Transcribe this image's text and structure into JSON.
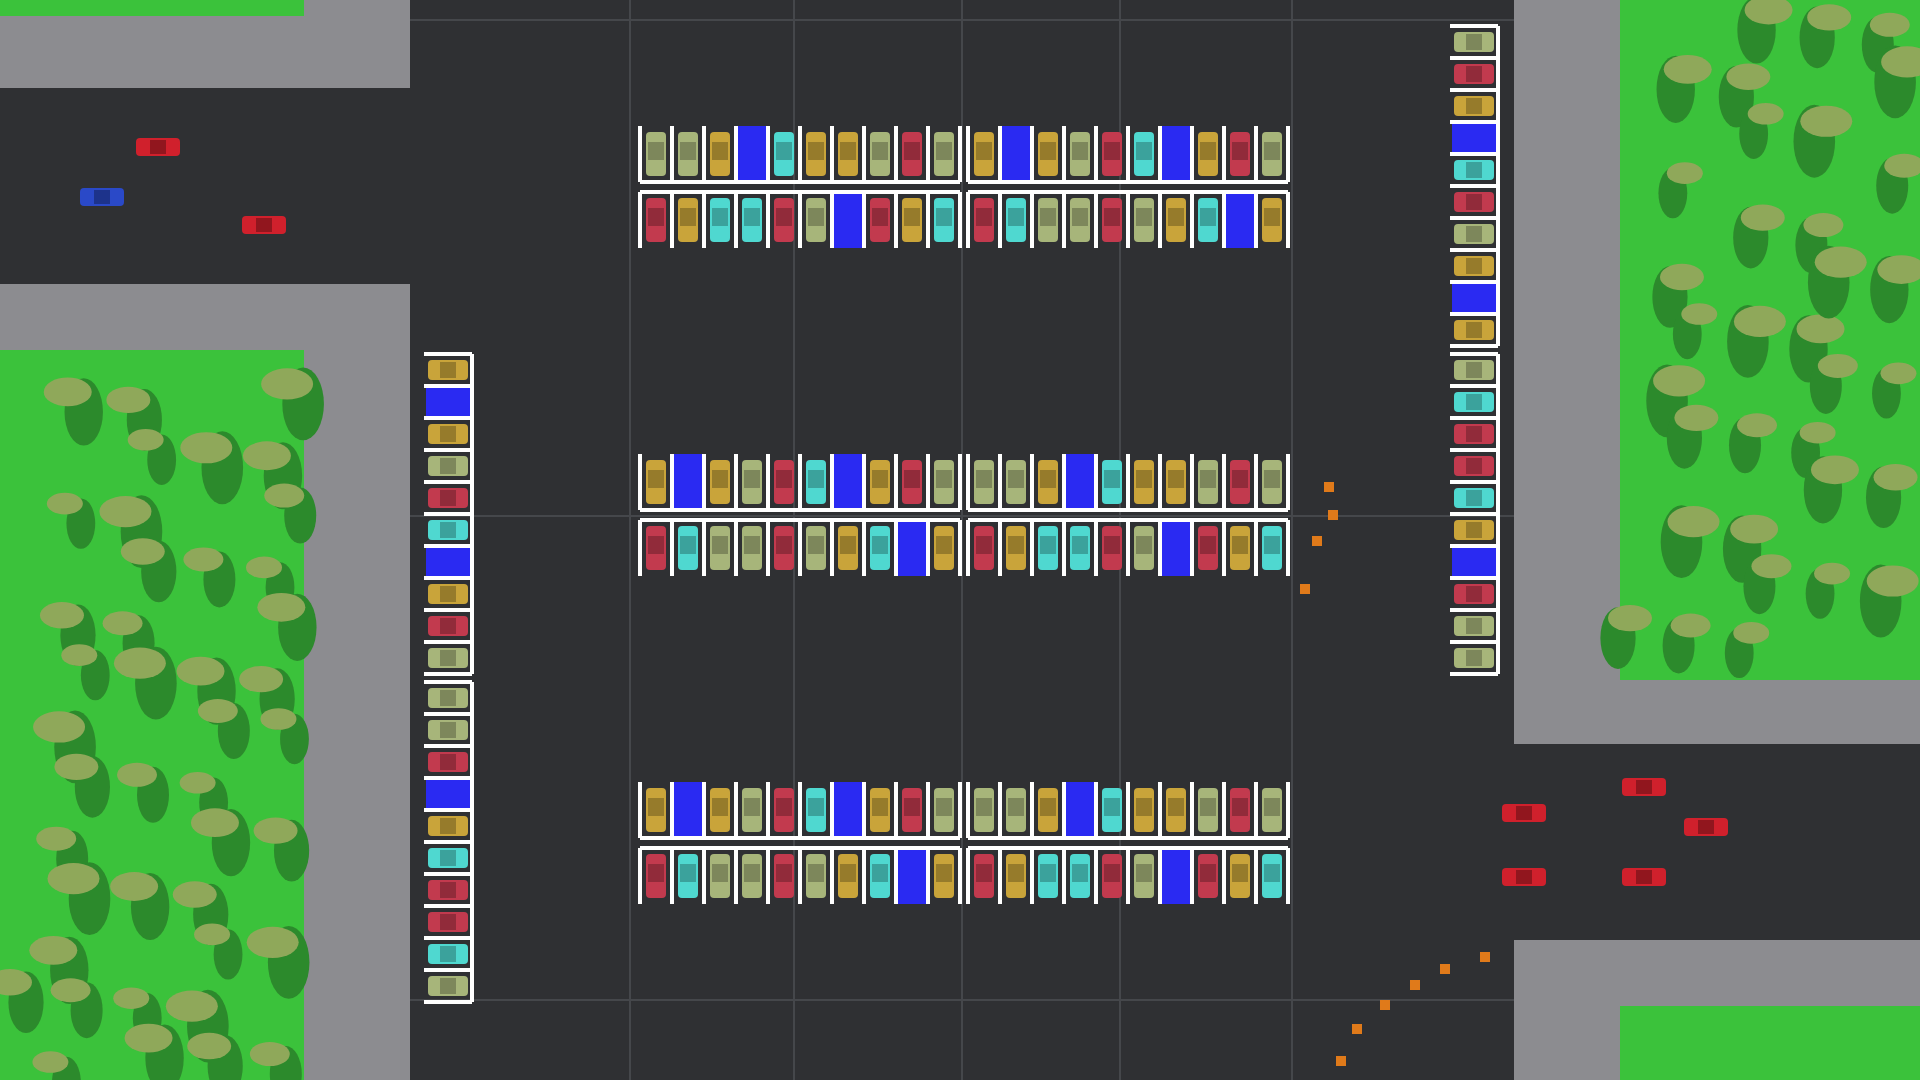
{
  "parking_rows": [
    {
      "spots": [
        {
          "kind": "car",
          "color": "#a7b57a"
        },
        {
          "kind": "car",
          "color": "#a7b57a"
        },
        {
          "kind": "car",
          "color": "#c9a43a"
        },
        {
          "kind": "empty"
        },
        {
          "kind": "car",
          "color": "#4fd8d0"
        },
        {
          "kind": "car",
          "color": "#c9a43a"
        },
        {
          "kind": "car",
          "color": "#c9a43a"
        },
        {
          "kind": "car",
          "color": "#a7b57a"
        },
        {
          "kind": "car",
          "color": "#c23a4e"
        },
        {
          "kind": "car",
          "color": "#a7b57a"
        },
        {
          "kind": "car",
          "color": "#c9a43a"
        },
        {
          "kind": "empty"
        },
        {
          "kind": "car",
          "color": "#c9a43a"
        },
        {
          "kind": "car",
          "color": "#a7b57a"
        },
        {
          "kind": "car",
          "color": "#c23a4e"
        },
        {
          "kind": "car",
          "color": "#4fd8d0"
        },
        {
          "kind": "empty"
        },
        {
          "kind": "car",
          "color": "#c9a43a"
        },
        {
          "kind": "car",
          "color": "#c23a4e"
        },
        {
          "kind": "car",
          "color": "#a7b57a"
        }
      ]
    },
    {
      "spots": [
        {
          "kind": "car",
          "color": "#c23a4e"
        },
        {
          "kind": "car",
          "color": "#c9a43a"
        },
        {
          "kind": "car",
          "color": "#4fd8d0"
        },
        {
          "kind": "car",
          "color": "#4fd8d0"
        },
        {
          "kind": "car",
          "color": "#c23a4e"
        },
        {
          "kind": "car",
          "color": "#a7b57a"
        },
        {
          "kind": "empty"
        },
        {
          "kind": "car",
          "color": "#c23a4e"
        },
        {
          "kind": "car",
          "color": "#c9a43a"
        },
        {
          "kind": "car",
          "color": "#4fd8d0"
        },
        {
          "kind": "car",
          "color": "#c23a4e"
        },
        {
          "kind": "car",
          "color": "#4fd8d0"
        },
        {
          "kind": "car",
          "color": "#a7b57a"
        },
        {
          "kind": "car",
          "color": "#a7b57a"
        },
        {
          "kind": "car",
          "color": "#c23a4e"
        },
        {
          "kind": "car",
          "color": "#a7b57a"
        },
        {
          "kind": "car",
          "color": "#c9a43a"
        },
        {
          "kind": "car",
          "color": "#4fd8d0"
        },
        {
          "kind": "empty"
        },
        {
          "kind": "car",
          "color": "#c9a43a"
        }
      ]
    },
    {
      "spots": [
        {
          "kind": "car",
          "color": "#c9a43a"
        },
        {
          "kind": "empty"
        },
        {
          "kind": "car",
          "color": "#c9a43a"
        },
        {
          "kind": "car",
          "color": "#a7b57a"
        },
        {
          "kind": "car",
          "color": "#c23a4e"
        },
        {
          "kind": "car",
          "color": "#4fd8d0"
        },
        {
          "kind": "empty"
        },
        {
          "kind": "car",
          "color": "#c9a43a"
        },
        {
          "kind": "car",
          "color": "#c23a4e"
        },
        {
          "kind": "car",
          "color": "#a7b57a"
        },
        {
          "kind": "car",
          "color": "#a7b57a"
        },
        {
          "kind": "car",
          "color": "#a7b57a"
        },
        {
          "kind": "car",
          "color": "#c9a43a"
        },
        {
          "kind": "empty"
        },
        {
          "kind": "car",
          "color": "#4fd8d0"
        },
        {
          "kind": "car",
          "color": "#c9a43a"
        },
        {
          "kind": "car",
          "color": "#c9a43a"
        },
        {
          "kind": "car",
          "color": "#a7b57a"
        },
        {
          "kind": "car",
          "color": "#c23a4e"
        },
        {
          "kind": "car",
          "color": "#a7b57a"
        }
      ]
    },
    {
      "spots": [
        {
          "kind": "car",
          "color": "#c23a4e"
        },
        {
          "kind": "car",
          "color": "#4fd8d0"
        },
        {
          "kind": "car",
          "color": "#a7b57a"
        },
        {
          "kind": "car",
          "color": "#a7b57a"
        },
        {
          "kind": "car",
          "color": "#c23a4e"
        },
        {
          "kind": "car",
          "color": "#a7b57a"
        },
        {
          "kind": "car",
          "color": "#c9a43a"
        },
        {
          "kind": "car",
          "color": "#4fd8d0"
        },
        {
          "kind": "empty"
        },
        {
          "kind": "car",
          "color": "#c9a43a"
        },
        {
          "kind": "car",
          "color": "#c23a4e"
        },
        {
          "kind": "car",
          "color": "#c9a43a"
        },
        {
          "kind": "car",
          "color": "#4fd8d0"
        },
        {
          "kind": "car",
          "color": "#4fd8d0"
        },
        {
          "kind": "car",
          "color": "#c23a4e"
        },
        {
          "kind": "car",
          "color": "#a7b57a"
        },
        {
          "kind": "empty"
        },
        {
          "kind": "car",
          "color": "#c23a4e"
        },
        {
          "kind": "car",
          "color": "#c9a43a"
        },
        {
          "kind": "car",
          "color": "#4fd8d0"
        }
      ]
    },
    {
      "spots": [
        {
          "kind": "car",
          "color": "#c9a43a"
        },
        {
          "kind": "empty"
        },
        {
          "kind": "car",
          "color": "#c9a43a"
        },
        {
          "kind": "car",
          "color": "#a7b57a"
        },
        {
          "kind": "car",
          "color": "#c23a4e"
        },
        {
          "kind": "car",
          "color": "#4fd8d0"
        },
        {
          "kind": "empty"
        },
        {
          "kind": "car",
          "color": "#c9a43a"
        },
        {
          "kind": "car",
          "color": "#c23a4e"
        },
        {
          "kind": "car",
          "color": "#a7b57a"
        },
        {
          "kind": "car",
          "color": "#a7b57a"
        },
        {
          "kind": "car",
          "color": "#a7b57a"
        },
        {
          "kind": "car",
          "color": "#c9a43a"
        },
        {
          "kind": "empty"
        },
        {
          "kind": "car",
          "color": "#4fd8d0"
        },
        {
          "kind": "car",
          "color": "#c9a43a"
        },
        {
          "kind": "car",
          "color": "#c9a43a"
        },
        {
          "kind": "car",
          "color": "#a7b57a"
        },
        {
          "kind": "car",
          "color": "#c23a4e"
        },
        {
          "kind": "car",
          "color": "#a7b57a"
        }
      ]
    },
    {
      "spots": [
        {
          "kind": "car",
          "color": "#c23a4e"
        },
        {
          "kind": "car",
          "color": "#4fd8d0"
        },
        {
          "kind": "car",
          "color": "#a7b57a"
        },
        {
          "kind": "car",
          "color": "#a7b57a"
        },
        {
          "kind": "car",
          "color": "#c23a4e"
        },
        {
          "kind": "car",
          "color": "#a7b57a"
        },
        {
          "kind": "car",
          "color": "#c9a43a"
        },
        {
          "kind": "car",
          "color": "#4fd8d0"
        },
        {
          "kind": "empty"
        },
        {
          "kind": "car",
          "color": "#c9a43a"
        },
        {
          "kind": "car",
          "color": "#c23a4e"
        },
        {
          "kind": "car",
          "color": "#c9a43a"
        },
        {
          "kind": "car",
          "color": "#4fd8d0"
        },
        {
          "kind": "car",
          "color": "#4fd8d0"
        },
        {
          "kind": "car",
          "color": "#c23a4e"
        },
        {
          "kind": "car",
          "color": "#a7b57a"
        },
        {
          "kind": "empty"
        },
        {
          "kind": "car",
          "color": "#c23a4e"
        },
        {
          "kind": "car",
          "color": "#c9a43a"
        },
        {
          "kind": "car",
          "color": "#4fd8d0"
        }
      ]
    }
  ],
  "side_columns": [
    {
      "spots": [
        {
          "kind": "car",
          "color": "#c9a43a"
        },
        {
          "kind": "empty"
        },
        {
          "kind": "car",
          "color": "#c9a43a"
        },
        {
          "kind": "car",
          "color": "#a7b57a"
        },
        {
          "kind": "car",
          "color": "#c23a4e"
        },
        {
          "kind": "car",
          "color": "#4fd8d0"
        },
        {
          "kind": "empty"
        },
        {
          "kind": "car",
          "color": "#c9a43a"
        },
        {
          "kind": "car",
          "color": "#c23a4e"
        },
        {
          "kind": "car",
          "color": "#a7b57a"
        },
        {
          "kind": "car",
          "color": "#a7b57a"
        },
        {
          "kind": "car",
          "color": "#a7b57a"
        },
        {
          "kind": "car",
          "color": "#c23a4e"
        },
        {
          "kind": "empty"
        },
        {
          "kind": "car",
          "color": "#c9a43a"
        },
        {
          "kind": "car",
          "color": "#4fd8d0"
        },
        {
          "kind": "car",
          "color": "#c23a4e"
        },
        {
          "kind": "car",
          "color": "#c23a4e"
        },
        {
          "kind": "car",
          "color": "#4fd8d0"
        },
        {
          "kind": "car",
          "color": "#a7b57a"
        }
      ]
    },
    {
      "spots": [
        {
          "kind": "car",
          "color": "#a7b57a"
        },
        {
          "kind": "car",
          "color": "#c23a4e"
        },
        {
          "kind": "car",
          "color": "#c9a43a"
        },
        {
          "kind": "empty"
        },
        {
          "kind": "car",
          "color": "#4fd8d0"
        },
        {
          "kind": "car",
          "color": "#c23a4e"
        },
        {
          "kind": "car",
          "color": "#a7b57a"
        },
        {
          "kind": "car",
          "color": "#c9a43a"
        },
        {
          "kind": "empty"
        },
        {
          "kind": "car",
          "color": "#c9a43a"
        },
        {
          "kind": "car",
          "color": "#a7b57a"
        },
        {
          "kind": "car",
          "color": "#4fd8d0"
        },
        {
          "kind": "car",
          "color": "#c23a4e"
        },
        {
          "kind": "car",
          "color": "#c23a4e"
        },
        {
          "kind": "car",
          "color": "#4fd8d0"
        },
        {
          "kind": "car",
          "color": "#c9a43a"
        },
        {
          "kind": "empty"
        },
        {
          "kind": "car",
          "color": "#c23a4e"
        },
        {
          "kind": "car",
          "color": "#a7b57a"
        },
        {
          "kind": "car",
          "color": "#a7b57a"
        }
      ]
    }
  ],
  "street_cars": [
    {
      "color": "#d0202c"
    },
    {
      "color": "#2a49c8"
    },
    {
      "color": "#d0202c"
    },
    {
      "color": "#d0202c"
    },
    {
      "color": "#d0202c"
    },
    {
      "color": "#d0202c"
    },
    {
      "color": "#d0202c"
    },
    {
      "color": "#d0202c"
    }
  ]
}
